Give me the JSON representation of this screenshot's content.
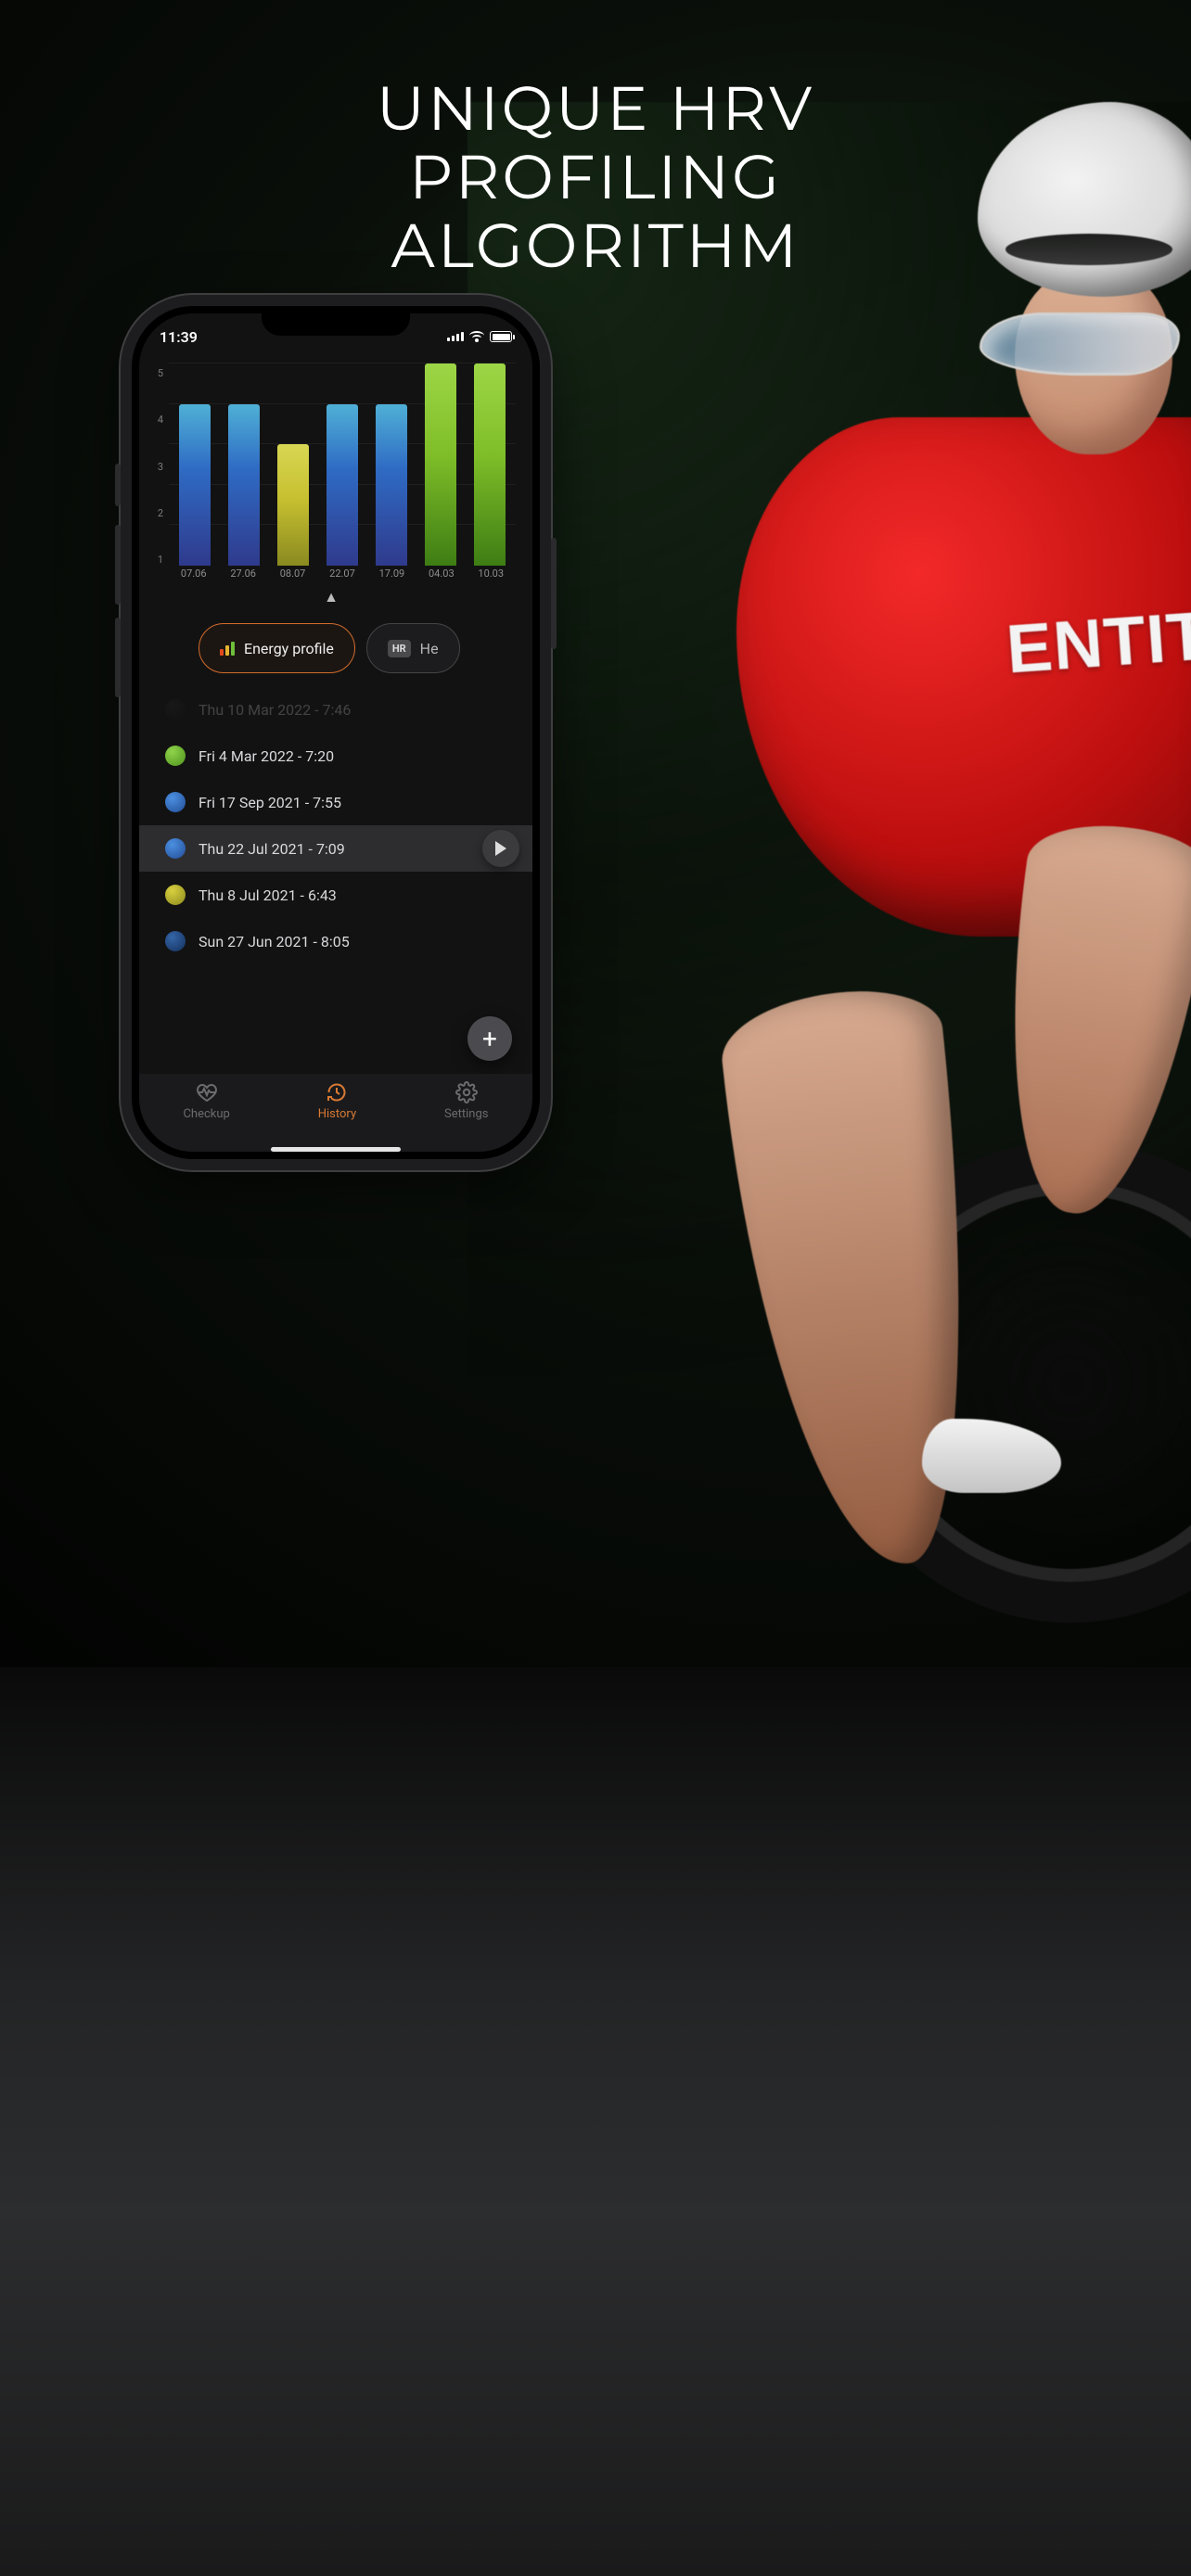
{
  "marketing": {
    "headline_line1": "UNIQUE HRV",
    "headline_line2": "PROFILING",
    "headline_line3": "ALGORITHM"
  },
  "background": {
    "jersey_text": "ENTIT"
  },
  "statusbar": {
    "time": "11:39"
  },
  "chart_data": {
    "type": "bar",
    "title": "",
    "xlabel": "",
    "ylabel": "",
    "ylim": [
      0,
      5
    ],
    "y_ticks": [
      1,
      2,
      3,
      4,
      5
    ],
    "categories": [
      "07.06",
      "27.06",
      "08.07",
      "22.07",
      "17.09",
      "04.03",
      "10.03"
    ],
    "values": [
      4,
      4,
      3,
      4,
      4,
      5,
      5
    ],
    "colors_by_index": [
      "blue",
      "blue",
      "yellow",
      "blue",
      "blue",
      "green",
      "green"
    ]
  },
  "pointer_glyph": "▲",
  "chips": {
    "energy_profile": "Energy profile",
    "heart_label_partial": "He",
    "hr_badge": "HR"
  },
  "history": {
    "faded_top": "Thu 10 Mar 2022 - 7:46",
    "items": [
      {
        "color": "green",
        "label": "Fri 4 Mar 2022 - 7:20"
      },
      {
        "color": "blue",
        "label": "Fri 17 Sep 2021 - 7:55"
      },
      {
        "color": "blue",
        "label": "Thu 22 Jul 2021 - 7:09",
        "selected": true
      },
      {
        "color": "yellow",
        "label": "Thu 8 Jul 2021 - 6:43"
      },
      {
        "color": "dkblue",
        "label": "Sun 27 Jun 2021 - 8:05"
      }
    ],
    "add_glyph": "+"
  },
  "tabs": {
    "checkup": "Checkup",
    "history": "History",
    "settings": "Settings"
  }
}
